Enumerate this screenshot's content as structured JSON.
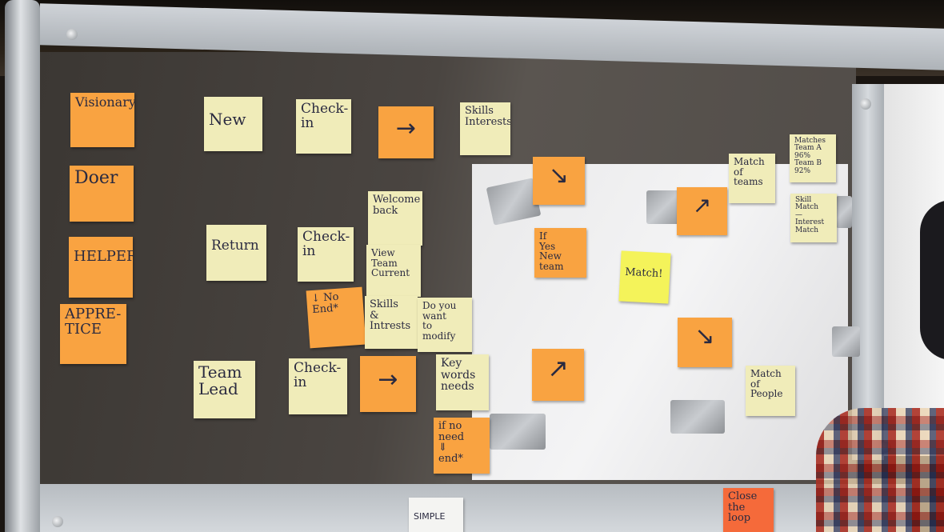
{
  "roles": {
    "visionary": "Visionary",
    "doer": "Doer",
    "helper": "HELPER",
    "apprentice": "APPRE-\nTICE"
  },
  "rows": {
    "new_label": "New",
    "return_label": "Return",
    "team_lead_label": "Team\nLead"
  },
  "steps": {
    "check_in": "Check-\nin",
    "arrow": "→",
    "skills_interests": "Skills\nInterests",
    "welcome_back": "Welcome\nback",
    "view_team": "View\nTeam\nCurrent",
    "no_end": "↓ No\nEnd*",
    "skills_intrests_2": "Skills\n&\nIntrests",
    "do_you_want": "Do you\nwant\nto modify",
    "key_words": "Key\nwords\nneeds",
    "if_no_need": "if no\nneed\n⇓\nend*"
  },
  "flow": {
    "down_right": "↘",
    "if_yes": "If\nYes\nNew team",
    "up_right_1": "↗",
    "match": "Match!",
    "down_right_2": "↘",
    "up_right_2": "↗",
    "match_of_teams": "Match\nof\nteams",
    "matches": "Matches\nTeam A 96%\nTeam B 92%",
    "skill_match": "Skill Match\n—\nInterest Match",
    "match_of_people": "Match\nof\nPeople"
  },
  "bottom": {
    "simple": "SIMPLE",
    "close": "Close\nthe\nloop"
  }
}
